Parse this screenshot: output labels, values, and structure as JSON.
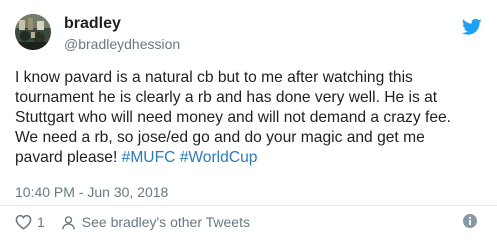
{
  "author": {
    "name": "bradley",
    "handle": "@bradleydhession"
  },
  "tweet": {
    "lines": [
      "I know pavard is a natural cb but to me after watching this",
      "tournament he is clearly a rb and has done very well. He is at",
      "Stuttgart who will need money and will not demand a crazy fee.",
      "We need a rb, so jose/ed go and do your magic and get me"
    ],
    "last_line_text": "pavard please! ",
    "hashtags": [
      "#MUFC",
      "#WorldCup"
    ],
    "timestamp": "10:40 PM - Jun 30, 2018"
  },
  "actions": {
    "like_count": "1",
    "profile_link": "See bradley's other Tweets"
  },
  "colors": {
    "text": "#1c2022",
    "secondary": "#697882",
    "link": "#2b7bb9",
    "twitter_blue": "#1da1f2",
    "divider": "#e1e8ed"
  }
}
